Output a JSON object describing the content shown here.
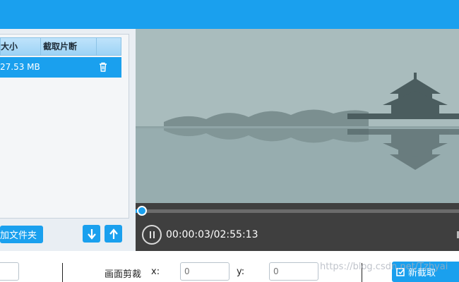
{
  "file_list": {
    "columns": {
      "size": "大小",
      "clip": "截取片断"
    },
    "rows": [
      {
        "size": "27.53 MB"
      }
    ]
  },
  "toolbar": {
    "add_folder_label": "加文件夹"
  },
  "player": {
    "time": "00:00:03/02:55:13",
    "progress_fraction": 0.0003
  },
  "crop": {
    "label": "画面剪裁",
    "x_label": "x:",
    "y_label": "y:",
    "x_placeholder": "0",
    "y_placeholder": "0"
  },
  "new_clip_label": "新截取",
  "watermark": "https://blog.csdn.net/Tzhyai",
  "colors": {
    "accent": "#1aa0ee",
    "controls_bg": "#3f3f3f"
  },
  "icons": [
    "trash-icon",
    "arrow-down-icon",
    "arrow-up-icon",
    "pause-icon",
    "new-clip-icon"
  ]
}
